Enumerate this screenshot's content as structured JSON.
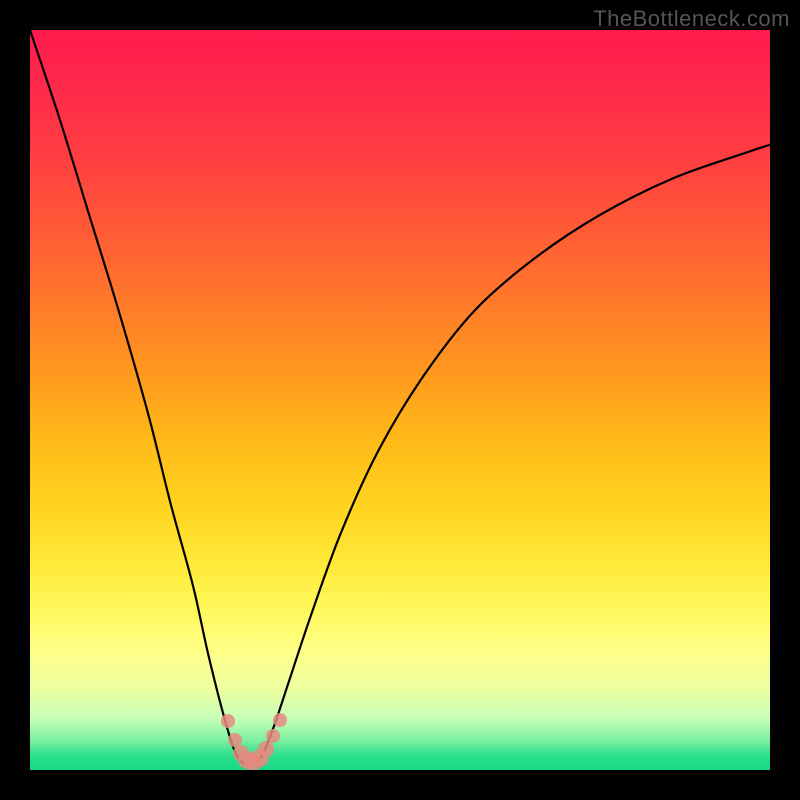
{
  "attribution": "TheBottleneck.com",
  "colors": {
    "page_bg": "#000000",
    "curve_stroke": "#000000",
    "marker_fill": "#e88a80",
    "attribution_text": "#555555"
  },
  "chart_data": {
    "type": "line",
    "title": "",
    "xlabel": "",
    "ylabel": "",
    "xlim": [
      0,
      100
    ],
    "ylim": [
      0,
      100
    ],
    "note": "Bottleneck-style V-curve. Values estimated from pixel positions; no axes or tick labels are present in the source image.",
    "series": [
      {
        "name": "curve",
        "x": [
          0,
          4,
          8,
          12,
          16,
          19,
          22,
          24,
          26,
          27.5,
          28.5,
          29.5,
          30.5,
          31.5,
          33,
          35,
          38,
          42,
          47,
          53,
          60,
          68,
          77,
          87,
          97,
          100
        ],
        "y": [
          100,
          88,
          75,
          62,
          48,
          36,
          25,
          16,
          8,
          3,
          1.2,
          0.8,
          1.0,
          2.2,
          6,
          12,
          21,
          32,
          43,
          53,
          62,
          69,
          75,
          80,
          83.5,
          84.5
        ]
      }
    ],
    "markers": {
      "name": "highlight-points",
      "points": [
        {
          "x": 26.7,
          "y": 6.6,
          "r": 7
        },
        {
          "x": 27.7,
          "y": 4.1,
          "r": 7
        },
        {
          "x": 28.5,
          "y": 2.3,
          "r": 8
        },
        {
          "x": 29.3,
          "y": 1.4,
          "r": 9
        },
        {
          "x": 30.2,
          "y": 1.1,
          "r": 9
        },
        {
          "x": 31.1,
          "y": 1.6,
          "r": 9
        },
        {
          "x": 31.9,
          "y": 2.8,
          "r": 8
        },
        {
          "x": 32.8,
          "y": 4.6,
          "r": 7
        },
        {
          "x": 33.8,
          "y": 6.8,
          "r": 7
        }
      ]
    }
  }
}
